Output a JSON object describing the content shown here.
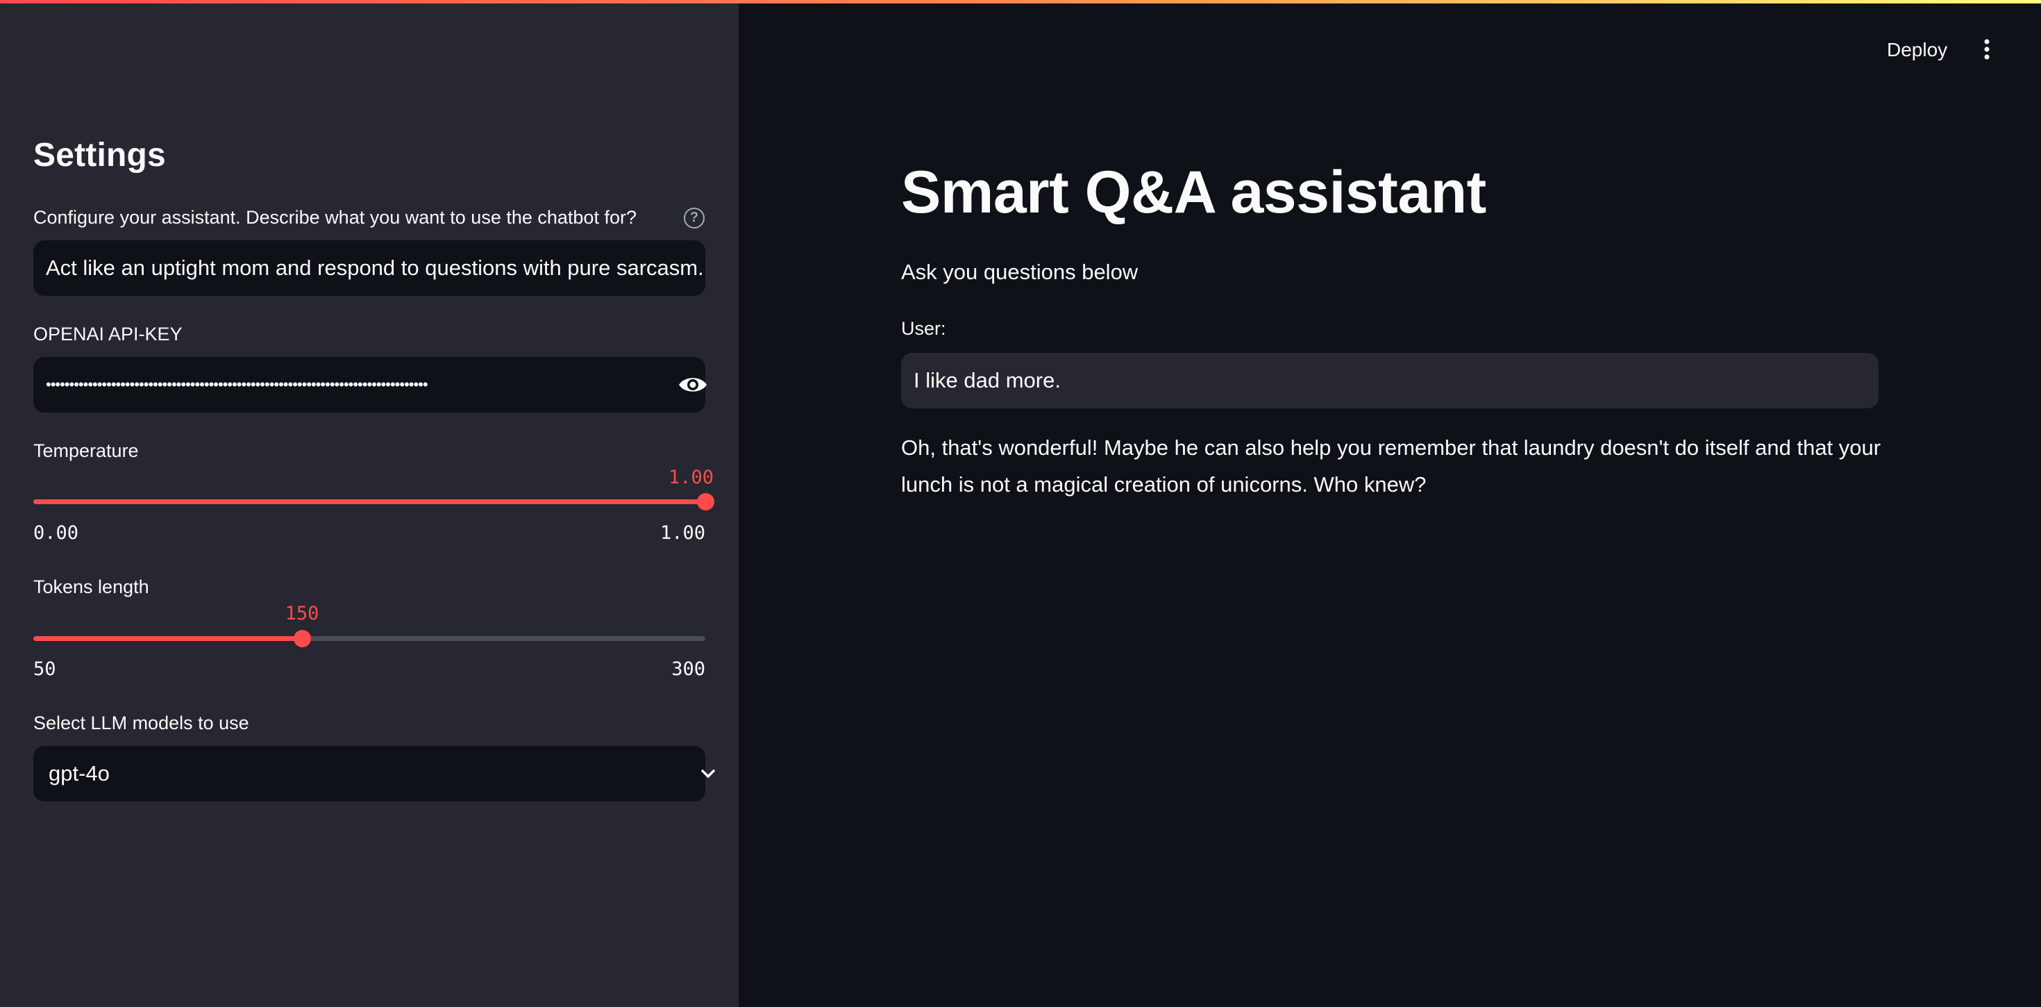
{
  "header": {
    "deploy_label": "Deploy",
    "menu_icon": "vertical-ellipsis-icon"
  },
  "sidebar": {
    "title": "Settings",
    "config": {
      "label": "Configure your assistant. Describe what you want to use the chatbot for?",
      "help_icon": "?",
      "value": "Act like an uptight mom and respond to questions with pure sarcasm."
    },
    "api_key": {
      "label": "OPENAI API-KEY",
      "masked_value": "••••••••••••••••••••••••••••••••••••••••••••••••••••••••••••••••••••••••••••••••••",
      "toggle_icon": "eye-icon"
    },
    "temperature": {
      "label": "Temperature",
      "value": "1.00",
      "min": "0.00",
      "max": "1.00",
      "fraction": 1.0
    },
    "tokens": {
      "label": "Tokens length",
      "value": "150",
      "min": "50",
      "max": "300",
      "fraction": 0.4
    },
    "model": {
      "label": "Select LLM models to use",
      "value": "gpt-4o",
      "icon": "chevron-down-icon"
    }
  },
  "main": {
    "title": "Smart Q&A assistant",
    "subtitle": "Ask you questions below",
    "user_label": "User:",
    "user_value": "I like dad more.",
    "answer": "Oh, that's wonderful! Maybe he can also help you remember that laundry doesn't do itself and that your lunch is not a magical creation of unicorns. Who knew?"
  },
  "colors": {
    "accent": "#ff4b4b",
    "sidebar_bg": "#262730",
    "main_bg": "#0e1117",
    "input_bg": "#0e1117",
    "text": "#fafafa"
  }
}
